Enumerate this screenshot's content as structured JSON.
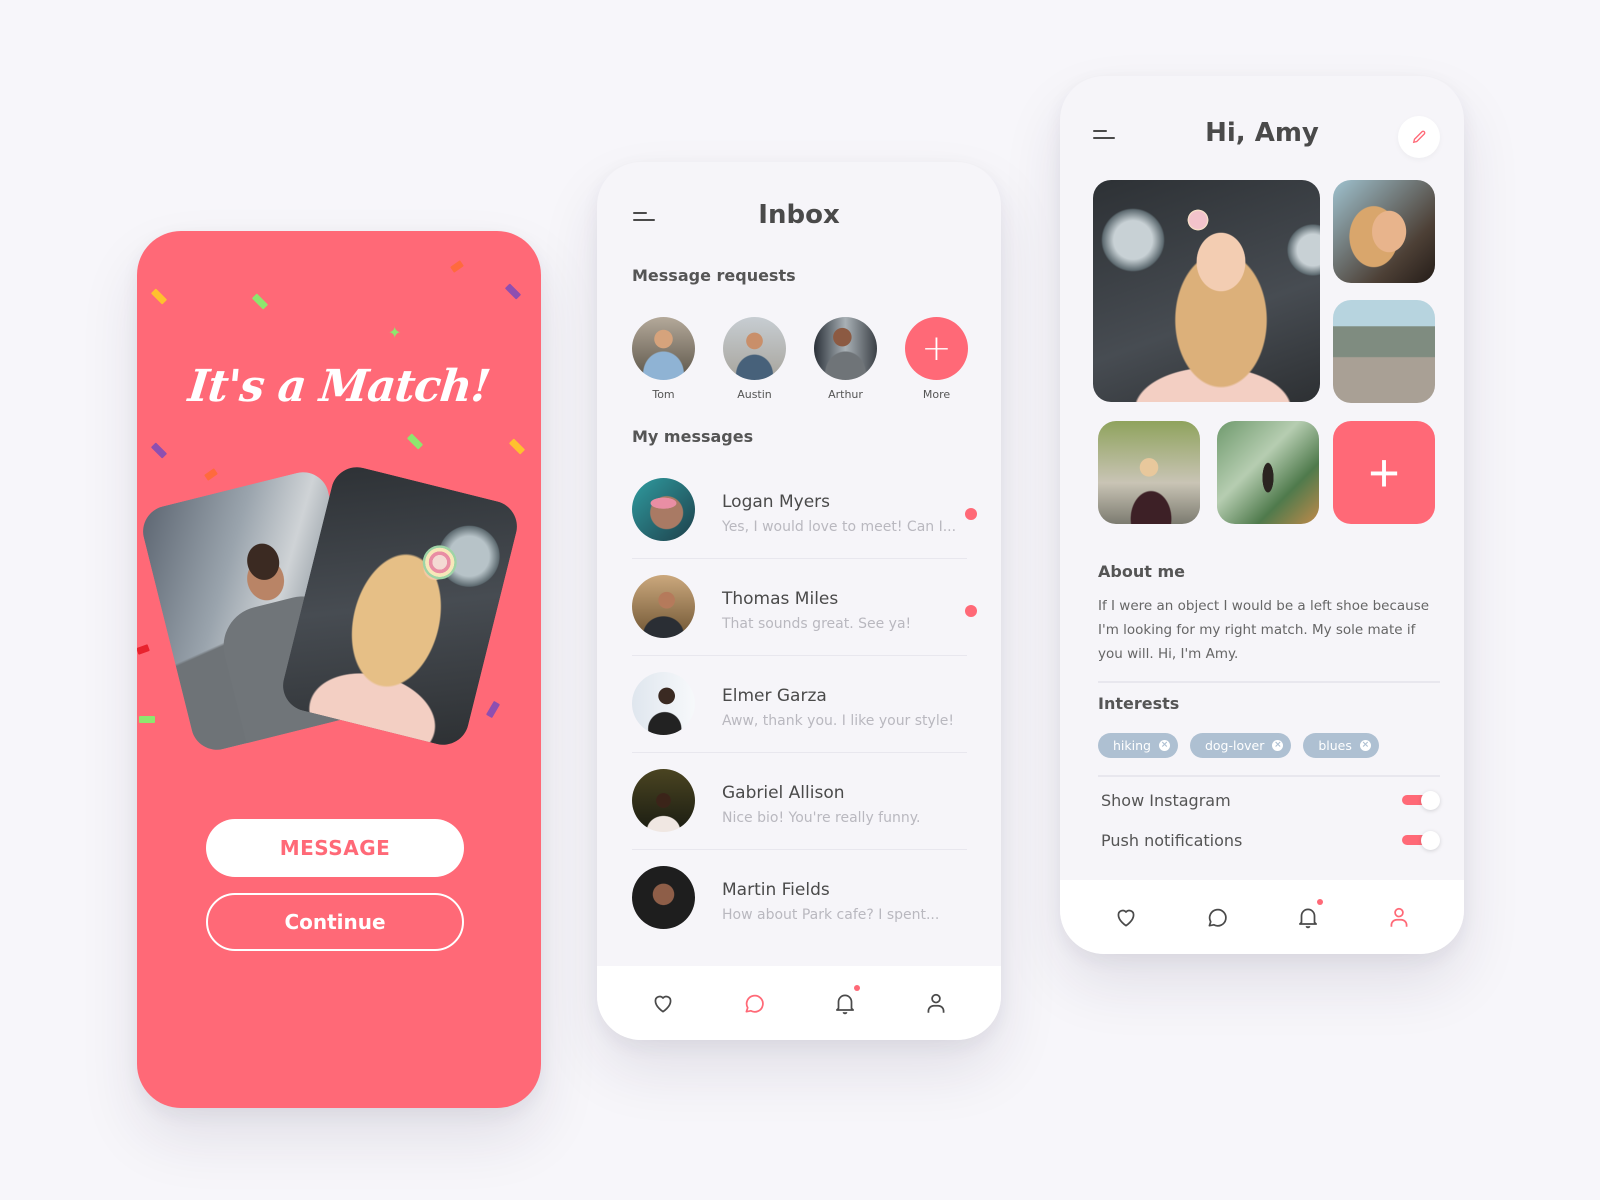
{
  "colors": {
    "accent": "#ff6977",
    "background": "#f7f6fa",
    "chip": "#aec0d2",
    "text": "#4a4a4a",
    "muted": "#b9b8bf"
  },
  "match_screen": {
    "title": "It's a Match!",
    "message_button": "MESSAGE",
    "continue_button": "Continue",
    "photos": [
      "man-photo",
      "woman-photo"
    ]
  },
  "inbox_screen": {
    "title": "Inbox",
    "menu_icon": "hamburger-menu-icon",
    "requests_label": "Message requests",
    "requests": [
      {
        "name": "Tom"
      },
      {
        "name": "Austin"
      },
      {
        "name": "Arthur"
      },
      {
        "name": "More",
        "icon": "plus-icon"
      }
    ],
    "messages_label": "My messages",
    "messages": [
      {
        "name": "Logan Myers",
        "preview": "Yes, I would love to meet! Can I...",
        "unread": true
      },
      {
        "name": "Thomas Miles",
        "preview": "That sounds great. See ya!",
        "unread": true
      },
      {
        "name": "Elmer Garza",
        "preview": "Aww, thank you. I like your style!",
        "unread": false
      },
      {
        "name": "Gabriel Allison",
        "preview": "Nice bio! You're really funny.",
        "unread": false
      },
      {
        "name": "Martin Fields",
        "preview": "How about Park cafe? I spent...",
        "unread": false
      }
    ],
    "tabbar": {
      "active": "messages",
      "items": [
        "heart-icon",
        "chat-icon",
        "bell-icon",
        "user-icon"
      ],
      "notification_badge": true
    }
  },
  "profile_screen": {
    "title": "Hi, Amy",
    "edit_icon": "pencil-icon",
    "add_photo": "+",
    "about_label": "About me",
    "about_text": "If I were an object I would be a left shoe because I'm looking for my right match. My sole mate if you will. Hi, I'm Amy.",
    "interests_label": "Interests",
    "interests": [
      "hiking",
      "dog-lover",
      "blues"
    ],
    "settings": [
      {
        "label": "Show Instagram",
        "enabled": true
      },
      {
        "label": "Push notifications",
        "enabled": true
      }
    ],
    "tabbar": {
      "active": "profile",
      "items": [
        "heart-icon",
        "chat-icon",
        "bell-icon",
        "user-icon"
      ],
      "notification_badge": true
    }
  }
}
